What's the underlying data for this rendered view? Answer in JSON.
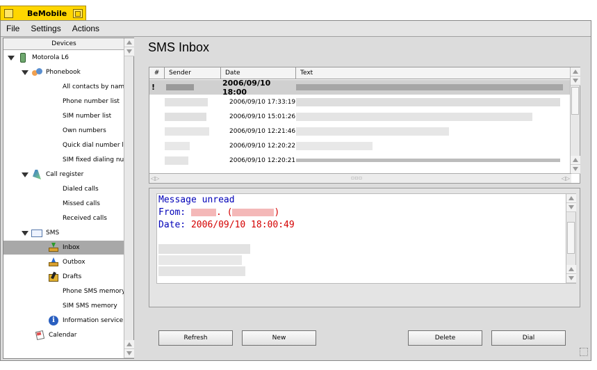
{
  "window": {
    "title": "BeMobile"
  },
  "menubar": {
    "items": [
      "File",
      "Settings",
      "Actions"
    ]
  },
  "sidebar": {
    "header": "Devices",
    "device": "Motorola L6",
    "phonebook": {
      "label": "Phonebook",
      "items": [
        "All contacts by name",
        "Phone number list",
        "SIM number list",
        "Own numbers",
        "Quick dial number list",
        "SIM fixed dialing number"
      ]
    },
    "call_register": {
      "label": "Call register",
      "items": [
        "Dialed calls",
        "Missed calls",
        "Received calls"
      ]
    },
    "sms": {
      "label": "SMS",
      "items": [
        "Inbox",
        "Outbox",
        "Drafts",
        "Phone SMS memory",
        "SIM SMS memory"
      ],
      "selected": "Inbox"
    },
    "information_service": "Information service",
    "calendar": "Calendar"
  },
  "main": {
    "heading": "SMS Inbox",
    "table": {
      "columns": [
        "#",
        "Sender",
        "Date",
        "Text"
      ],
      "rows": [
        {
          "flag": "!",
          "date": "2006/09/10 18:00",
          "unread": true
        },
        {
          "flag": "",
          "date": "2006/09/10 17:33:19",
          "unread": false
        },
        {
          "flag": "",
          "date": "2006/09/10 15:01:26",
          "unread": false
        },
        {
          "flag": "",
          "date": "2006/09/10 12:21:46",
          "unread": false
        },
        {
          "flag": "",
          "date": "2006/09/10 12:20:22",
          "unread": false
        },
        {
          "flag": "",
          "date": "2006/09/10 12:20:21",
          "unread": false
        }
      ]
    },
    "message": {
      "status": "Message unread",
      "from_label": "From:",
      "from_open": ". (",
      "from_close": ")",
      "date_label": "Date:",
      "date_value": "2006/09/10 18:00:49"
    },
    "buttons": {
      "refresh": "Refresh",
      "new": "New",
      "delete": "Delete",
      "dial": "Dial"
    }
  },
  "colors": {
    "title_tab": "#ffd600",
    "selection": "#a8a8a8",
    "status_blue": "#0000b8",
    "date_red": "#d40000"
  }
}
